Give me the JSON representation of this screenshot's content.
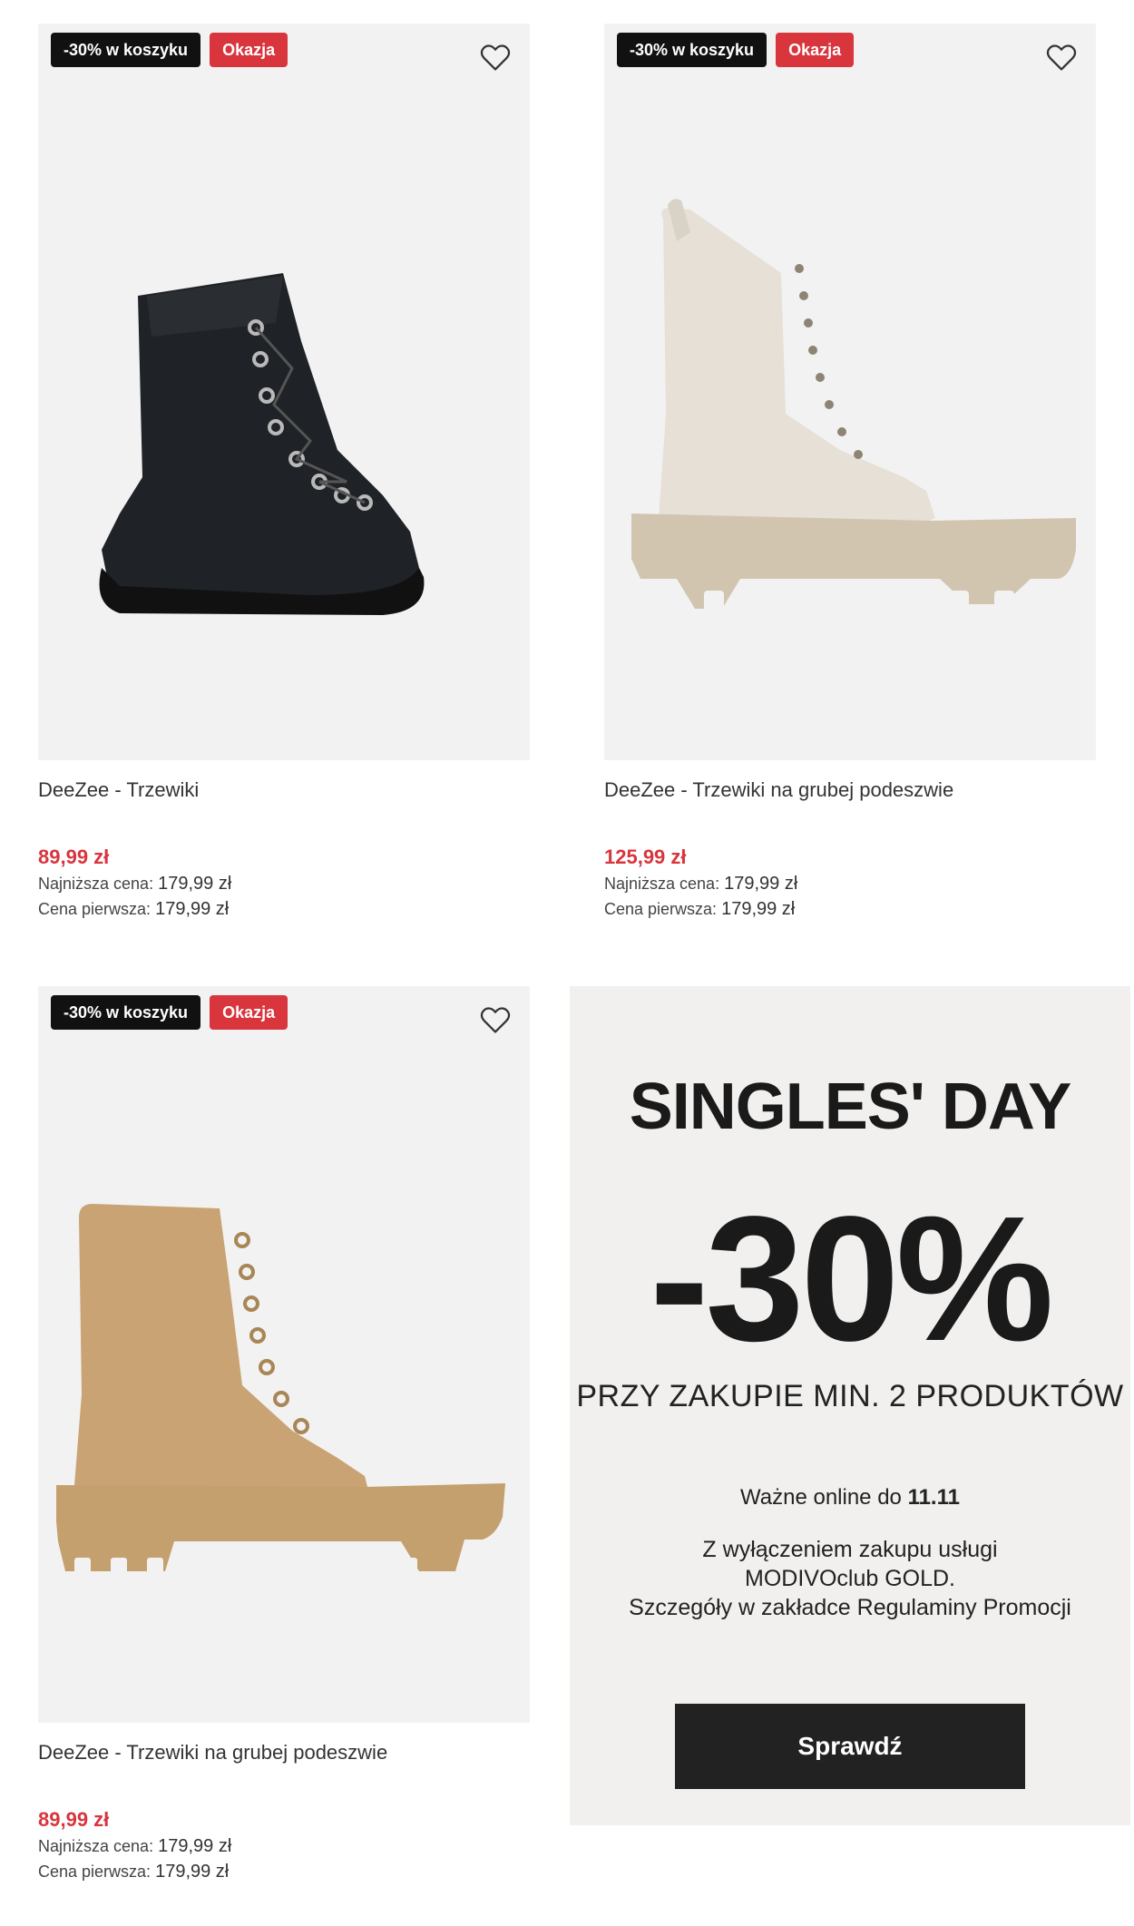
{
  "products": [
    {
      "badge_discount": "-30% w koszyku",
      "badge_deal": "Okazja",
      "name": "DeeZee - Trzewiki",
      "price": "89,99 zł",
      "lowest_label": "Najniższa cena:",
      "lowest_value": "179,99 zł",
      "original_label": "Cena pierwsza:",
      "original_value": "179,99 zł",
      "image_color": "#1f2226"
    },
    {
      "badge_discount": "-30% w koszyku",
      "badge_deal": "Okazja",
      "name": "DeeZee - Trzewiki na grubej podeszwie",
      "price": "125,99 zł",
      "lowest_label": "Najniższa cena:",
      "lowest_value": "179,99 zł",
      "original_label": "Cena pierwsza:",
      "original_value": "179,99 zł",
      "image_color": "#e6e0d7"
    },
    {
      "badge_discount": "-30% w koszyku",
      "badge_deal": "Okazja",
      "name": "DeeZee - Trzewiki na grubej podeszwie",
      "price": "89,99 zł",
      "lowest_label": "Najniższa cena:",
      "lowest_value": "179,99 zł",
      "original_label": "Cena pierwsza:",
      "original_value": "179,99 zł",
      "image_color": "#c9a373"
    }
  ],
  "promo": {
    "title": "SINGLES' DAY",
    "discount": "-30%",
    "condition": "PRZY ZAKUPIE MIN. 2 PRODUKTÓW",
    "valid_prefix": "Ważne online do",
    "valid_date": "11.11",
    "fine_line1": "Z wyłączeniem zakupu usługi",
    "fine_line2": "MODIVOclub GOLD.",
    "fine_line3": "Szczegóły w zakładce Regulaminy Promocji",
    "button": "Sprawdź"
  },
  "colors": {
    "sale_red": "#d8353d",
    "badge_dark": "#111111",
    "image_bg": "#f2f2f2",
    "promo_bg": "#f1f0ee"
  },
  "icons": [
    "heart-outline-icon"
  ]
}
